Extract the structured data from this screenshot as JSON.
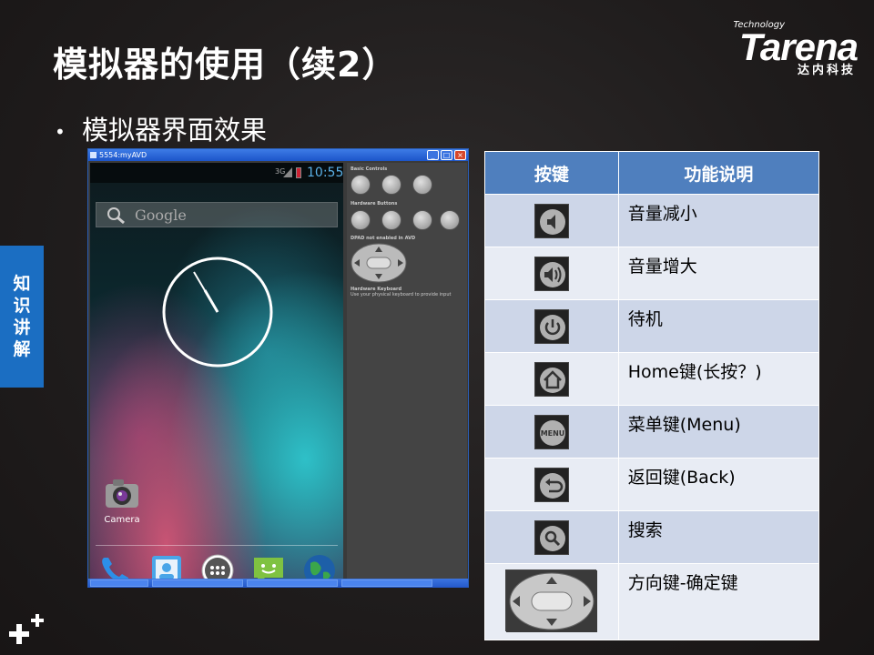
{
  "slide": {
    "title": "模拟器的使用（续2）",
    "bullet": "模拟器界面效果",
    "side_tab": [
      "知",
      "识",
      "讲",
      "解"
    ]
  },
  "logo": {
    "technology": "Technology",
    "name": "Tarena",
    "subtitle": "达内科技"
  },
  "emulator": {
    "window_title": "5554:myAVD",
    "status_time": "10:55",
    "status_network": "3G",
    "search_placeholder": "Google",
    "camera_label": "Camera",
    "controls": {
      "basic_controls_label": "Basic Controls",
      "hardware_buttons_label": "Hardware Buttons",
      "dpad_label": "DPAD not enabled in AVD",
      "keyboard_label": "Hardware Keyboard",
      "keyboard_note": "Use your physical keyboard to provide input"
    }
  },
  "table": {
    "header_key": "按键",
    "header_desc": "功能说明",
    "rows": [
      {
        "icon": "volume-down-icon",
        "desc": "音量减小"
      },
      {
        "icon": "volume-up-icon",
        "desc": "音量增大"
      },
      {
        "icon": "power-icon",
        "desc": "待机"
      },
      {
        "icon": "home-icon",
        "desc": "Home键(长按？)"
      },
      {
        "icon": "menu-icon",
        "desc": "菜单键(Menu)"
      },
      {
        "icon": "back-icon",
        "desc": "返回键(Back)"
      },
      {
        "icon": "search-icon",
        "desc": "搜索"
      },
      {
        "icon": "dpad-icon",
        "desc": "方向键-确定键"
      }
    ]
  },
  "colors": {
    "accent_blue": "#1b6ec2",
    "table_header": "#4f7fbe",
    "status_time": "#5ab0e6"
  }
}
